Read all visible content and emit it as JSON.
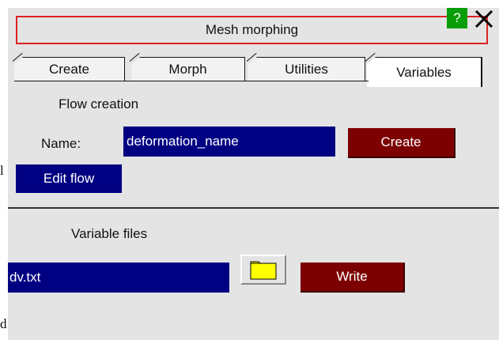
{
  "window": {
    "title": "Mesh morphing",
    "help_label": "?"
  },
  "edge_marks": [
    "l",
    "d"
  ],
  "tabs": [
    {
      "label": "Create",
      "active": false
    },
    {
      "label": "Morph",
      "active": false
    },
    {
      "label": "Utilities",
      "active": false
    },
    {
      "label": "Variables",
      "active": true
    }
  ],
  "flow": {
    "section_title": "Flow creation",
    "name_label": "Name:",
    "name_value": "deformation_name",
    "create_label": "Create",
    "edit_label": "Edit flow"
  },
  "variables": {
    "section_title": "Variable files",
    "file_value": "dv.txt",
    "write_label": "Write"
  },
  "icons": {
    "close": "close-icon",
    "folder": "folder-icon"
  },
  "colors": {
    "panel_bg": "#e4e4e4",
    "field_blue": "#000082",
    "button_red": "#7d0000",
    "help_green": "#0a9e0a",
    "title_border": "#dd2222",
    "folder_yellow": "#ffff00"
  }
}
